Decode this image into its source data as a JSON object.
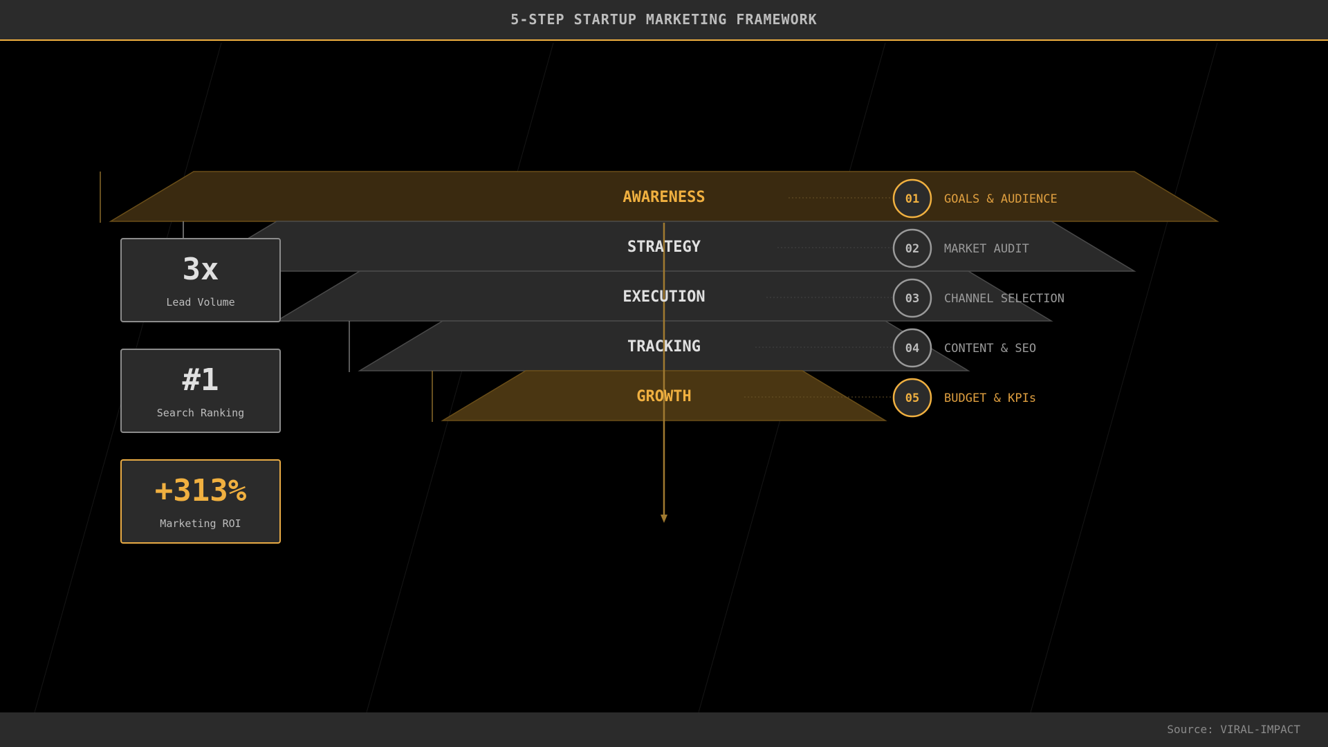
{
  "header": {
    "title": "5-STEP STARTUP MARKETING FRAMEWORK"
  },
  "funnel": {
    "levels": [
      {
        "label": "AWARENESS",
        "number": "01",
        "description": "GOALS & AUDIENCE",
        "highlight": true
      },
      {
        "label": "STRATEGY",
        "number": "02",
        "description": "MARKET AUDIT",
        "highlight": false
      },
      {
        "label": "EXECUTION",
        "number": "03",
        "description": "CHANNEL SELECTION",
        "highlight": false
      },
      {
        "label": "TRACKING",
        "number": "04",
        "description": "CONTENT & SEO",
        "highlight": false
      },
      {
        "label": "GROWTH",
        "number": "05",
        "description": "BUDGET & KPIs",
        "highlight": true
      }
    ]
  },
  "stats": [
    {
      "value": "3x",
      "label": "Lead Volume",
      "accent": false
    },
    {
      "value": "#1",
      "label": "Search Ranking",
      "accent": false
    },
    {
      "value": "+313%",
      "label": "Marketing ROI",
      "accent": true
    }
  ],
  "footer": {
    "source": "Source: VIRAL-IMPACT"
  },
  "colors": {
    "accent": "#f0b040",
    "background": "#000000",
    "panel": "#2b2b2b",
    "highlight_fill": "#3a2a10",
    "growth_fill": "#4a3612",
    "neutral_fill": "#2a2a2a"
  }
}
